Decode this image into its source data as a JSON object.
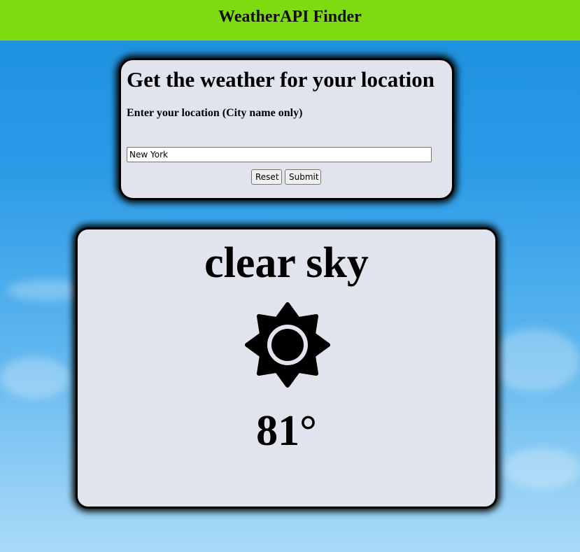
{
  "header": {
    "title": "WeatherAPI Finder"
  },
  "search": {
    "heading": "Get the weather for your location",
    "label": "Enter your location (City name only)",
    "input_value": "New York",
    "reset_label": "Reset",
    "submit_label": "Submit"
  },
  "weather": {
    "condition": "clear sky",
    "icon": "sun-icon",
    "temperature": "81°"
  },
  "colors": {
    "header_bg": "#7ddb10",
    "card_bg": "#e1e4ec"
  }
}
